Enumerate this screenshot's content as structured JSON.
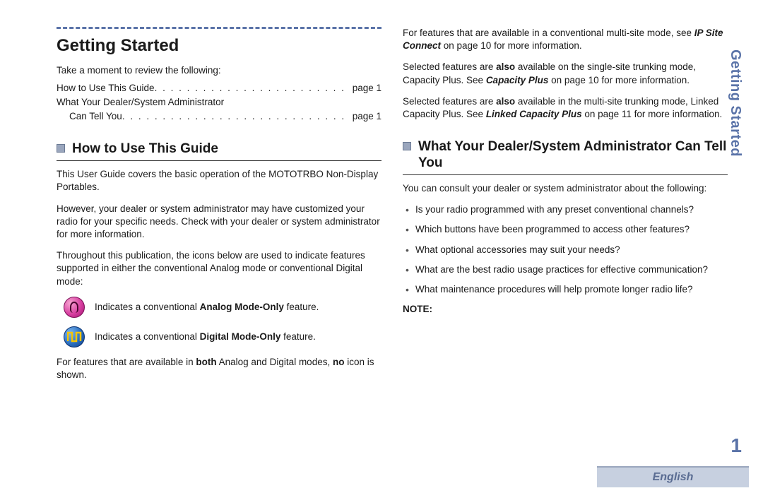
{
  "sidebar_tab": "Getting Started",
  "page_number": "1",
  "language": "English",
  "main_heading": "Getting Started",
  "intro": "Take a moment to review the following:",
  "toc": [
    {
      "label": "How to Use This Guide",
      "page": "page 1",
      "sub": false
    },
    {
      "label": "What Your Dealer/System Administrator",
      "page": "",
      "sub": false
    },
    {
      "label": "Can Tell You",
      "page": "page 1",
      "sub": true
    }
  ],
  "section1": {
    "heading": "How to Use This Guide",
    "p1a": "This User Guide covers the basic operation of the ",
    "p1b": "MOTOTRBO",
    "p1c": " Non-Display Portables.",
    "p2": "However, your dealer or system administrator may have customized your radio for your specific needs. Check with your dealer or system administrator for more information.",
    "p3": "Throughout this publication, the icons below are used to indicate features supported in either the conventional Analog mode or conventional Digital mode:",
    "analog_a": "Indicates a conventional ",
    "analog_b": "Analog Mode-Only",
    "analog_c": " feature.",
    "digital_a": "Indicates a conventional ",
    "digital_b": "Digital Mode-Only",
    "digital_c": " feature.",
    "p4a": "For features that are available in ",
    "p4b": "both",
    "p4c": " Analog and Digital modes, ",
    "p4d": "no",
    "p4e": " icon is shown."
  },
  "col2top": {
    "p1a": "For features that are available in a conventional multi-site mode, see ",
    "p1b": "IP Site Connect",
    "p1c": " on page 10 for more information.",
    "p2a": "Selected features are ",
    "p2b": "also",
    "p2c": " available on the single-site trunking mode, Capacity Plus. See ",
    "p2d": "Capacity Plus",
    "p2e": " on page 10 for more information.",
    "p3a": "Selected features are ",
    "p3b": "also",
    "p3c": " available in the multi-site trunking mode, Linked Capacity Plus. See ",
    "p3d": "Linked Capacity Plus",
    "p3e": " on page 11 for more information."
  },
  "section2": {
    "heading": "What Your Dealer/System Administrator Can Tell You",
    "intro": "You can consult your dealer or system administrator about the following:",
    "bullets": [
      "Is your radio programmed with any preset conventional channels?",
      "Which buttons have been programmed to access other features?",
      "What optional accessories may suit your needs?",
      "What are the best radio usage practices for effective communication?",
      "What maintenance procedures will help promote longer radio life?"
    ],
    "note": "NOTE:"
  }
}
